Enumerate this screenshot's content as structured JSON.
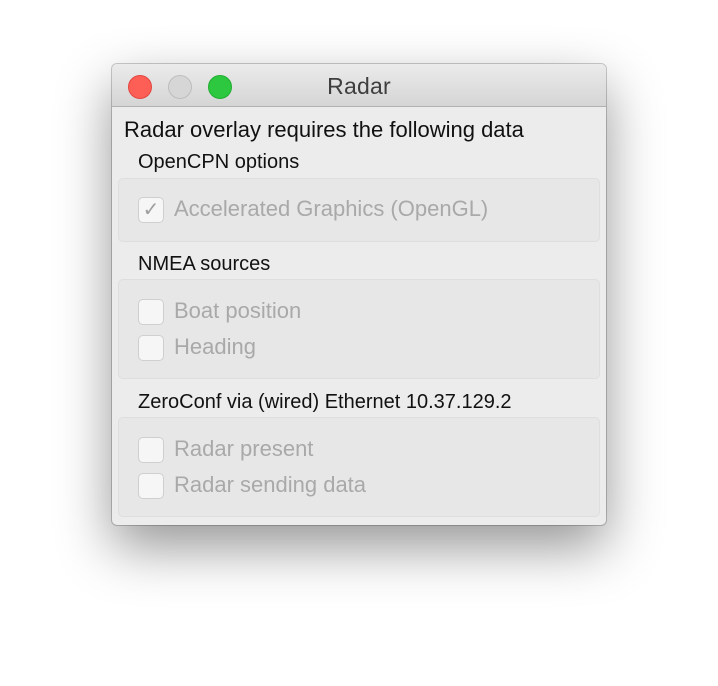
{
  "window": {
    "title": "Radar"
  },
  "heading": "Radar overlay requires the following data",
  "sections": [
    {
      "label": "OpenCPN options",
      "items": [
        {
          "label": "Accelerated Graphics (OpenGL)",
          "checked": true,
          "check_glyph": "✓"
        }
      ]
    },
    {
      "label": "NMEA sources",
      "items": [
        {
          "label": "Boat position",
          "checked": false,
          "check_glyph": ""
        },
        {
          "label": "Heading",
          "checked": false,
          "check_glyph": ""
        }
      ]
    },
    {
      "label": "ZeroConf via (wired) Ethernet 10.37.129.2",
      "items": [
        {
          "label": "Radar present",
          "checked": false,
          "check_glyph": ""
        },
        {
          "label": "Radar sending data",
          "checked": false,
          "check_glyph": ""
        }
      ]
    }
  ],
  "colors": {
    "close": "#fd5f57",
    "minimize": "#d6d6d6",
    "zoom": "#2dc840",
    "disabled_text": "#a9a9a9"
  }
}
